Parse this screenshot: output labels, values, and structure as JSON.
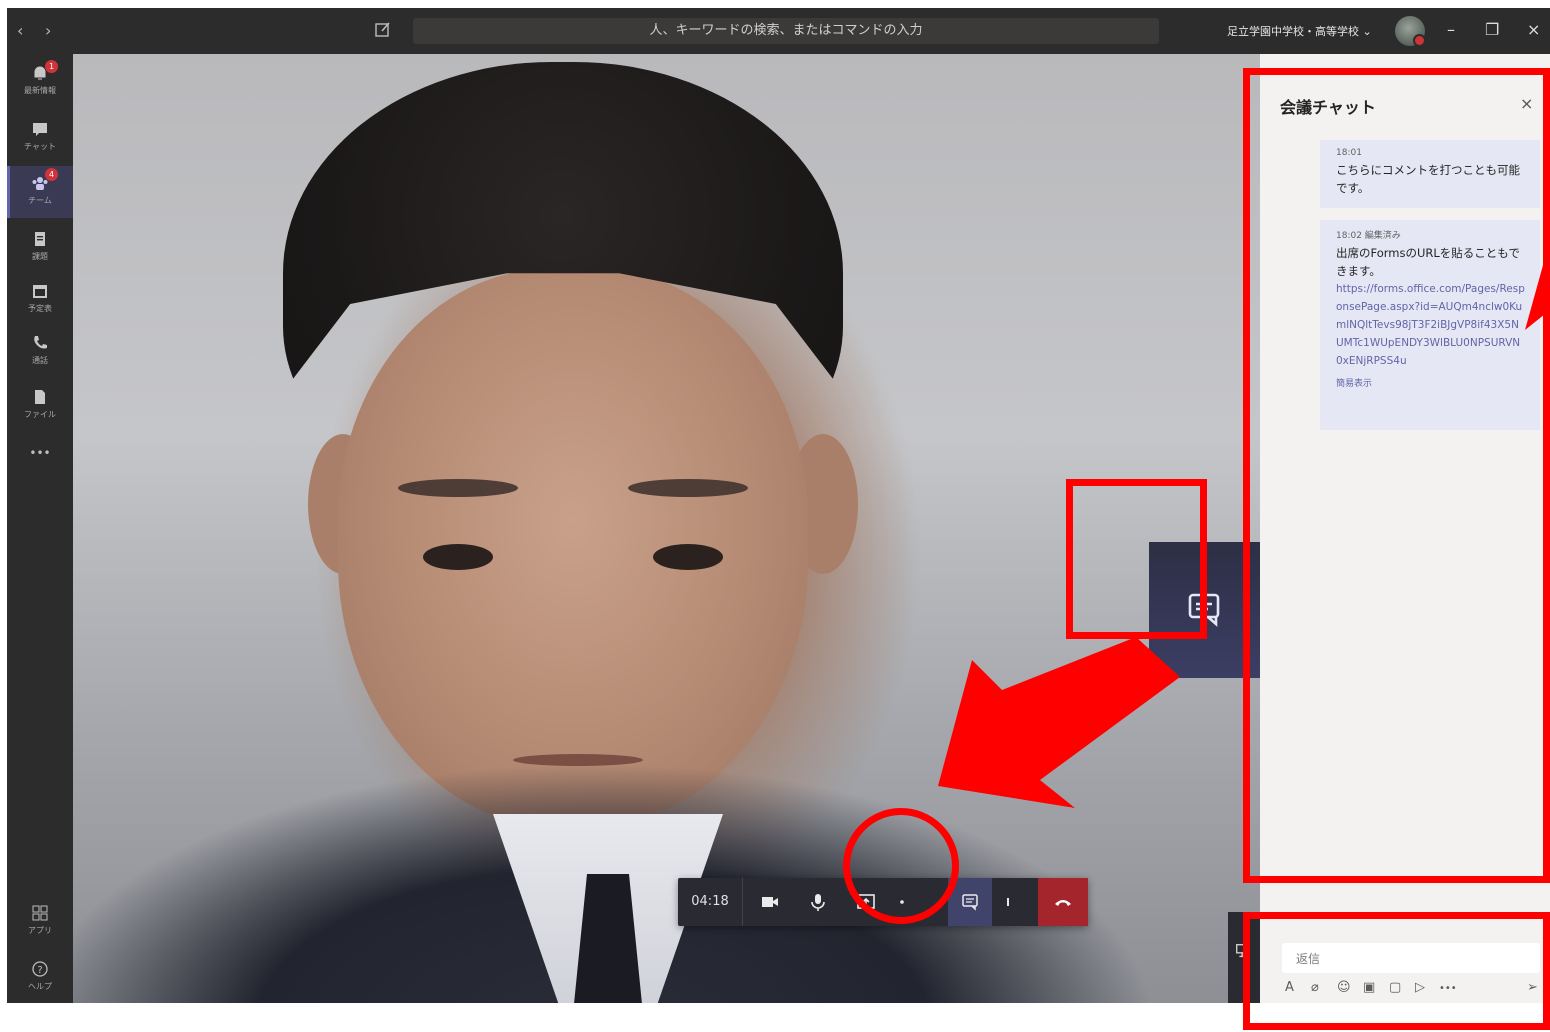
{
  "titlebar": {
    "nav_back": "‹",
    "nav_forward": "›",
    "search_placeholder": "人、キーワードの検索、またはコマンドの入力",
    "org_name": "足立学園中学校・高等学校 ⌄",
    "minimize": "–",
    "maximize": "❐",
    "close": "×"
  },
  "rail": {
    "items": [
      {
        "label": "最新情報",
        "icon": "bell-icon",
        "badge": "1"
      },
      {
        "label": "チャット",
        "icon": "chat-icon"
      },
      {
        "label": "チーム",
        "icon": "teams-icon",
        "badge": "4"
      },
      {
        "label": "課題",
        "icon": "assignments-icon"
      },
      {
        "label": "予定表",
        "icon": "calendar-icon"
      },
      {
        "label": "通話",
        "icon": "phone-icon"
      },
      {
        "label": "ファイル",
        "icon": "file-icon"
      },
      {
        "label": "•••",
        "icon": "more-icon"
      }
    ],
    "bottom": [
      {
        "label": "アプリ",
        "icon": "apps-icon"
      },
      {
        "label": "ヘルプ",
        "icon": "help-icon"
      }
    ]
  },
  "call": {
    "timer": "04:18"
  },
  "chat_panel": {
    "title": "会議チャット",
    "close": "×",
    "messages": [
      {
        "time": "18:01",
        "text": "こちらにコメントを打つことも可能です。"
      },
      {
        "time": "18:02 編集済み",
        "text": "出席のFormsのURLを貼ることもできます。",
        "link": "https://forms.office.com/Pages/ResponsePage.aspx?id=AUQm4nclw0KumlNQltTevs98jT3F2iBJgVP8if43X5NUMTc1WUpENDY3WlBLU0NPSURVN0xENjRPSS4u",
        "more": "簡易表示"
      }
    ],
    "reply_placeholder": "返信",
    "compose_more": "•••"
  },
  "colors": {
    "annotation": "#ff0000",
    "teams_purple": "#6264a7",
    "hangup_red": "#a4262c"
  }
}
